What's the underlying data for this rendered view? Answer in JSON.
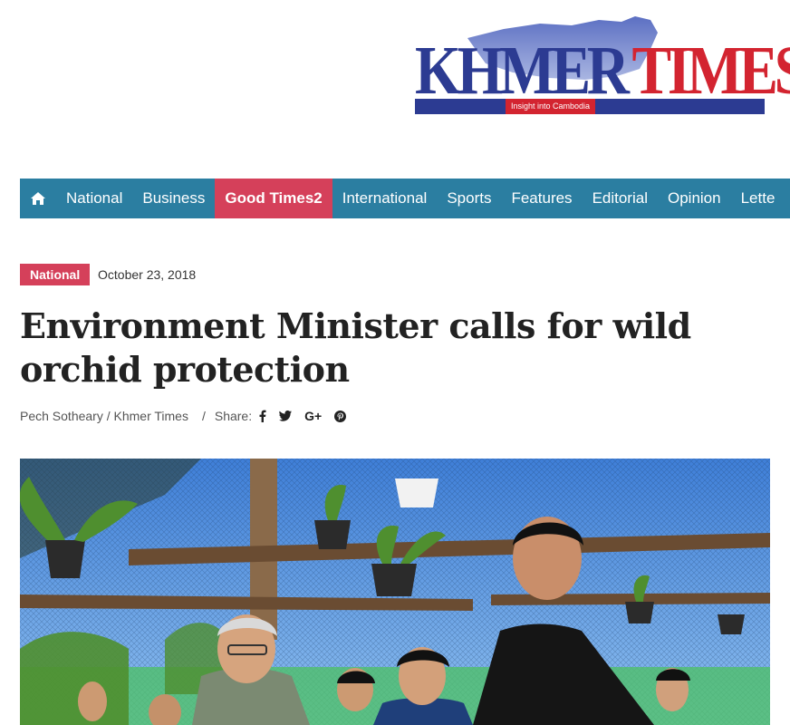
{
  "logo": {
    "name_part1": "KHMER",
    "name_part2": "TIMES",
    "tagline": "Insight into Cambodia",
    "colors": {
      "blue": "#2c3b92",
      "red": "#d32430"
    }
  },
  "nav": {
    "home_icon": "home-icon",
    "items": [
      {
        "label": "National",
        "active": false
      },
      {
        "label": "Business",
        "active": false
      },
      {
        "label": "Good Times2",
        "active": true
      },
      {
        "label": "International",
        "active": false
      },
      {
        "label": "Sports",
        "active": false
      },
      {
        "label": "Features",
        "active": false
      },
      {
        "label": "Editorial",
        "active": false
      },
      {
        "label": "Opinion",
        "active": false
      },
      {
        "label": "Lette",
        "active": false
      }
    ],
    "colors": {
      "bar": "#2b7ea1",
      "active": "#d5405a"
    }
  },
  "article": {
    "category": "National",
    "date": "October 23, 2018",
    "title": "Environment Minister calls for wild orchid protection",
    "byline": "Pech Sotheary / Khmer Times",
    "separator": "/",
    "share_label": "Share:",
    "share_icons": [
      "facebook-icon",
      "twitter-icon",
      "google-plus-icon",
      "pinterest-icon"
    ],
    "gplus_text": "G+"
  }
}
